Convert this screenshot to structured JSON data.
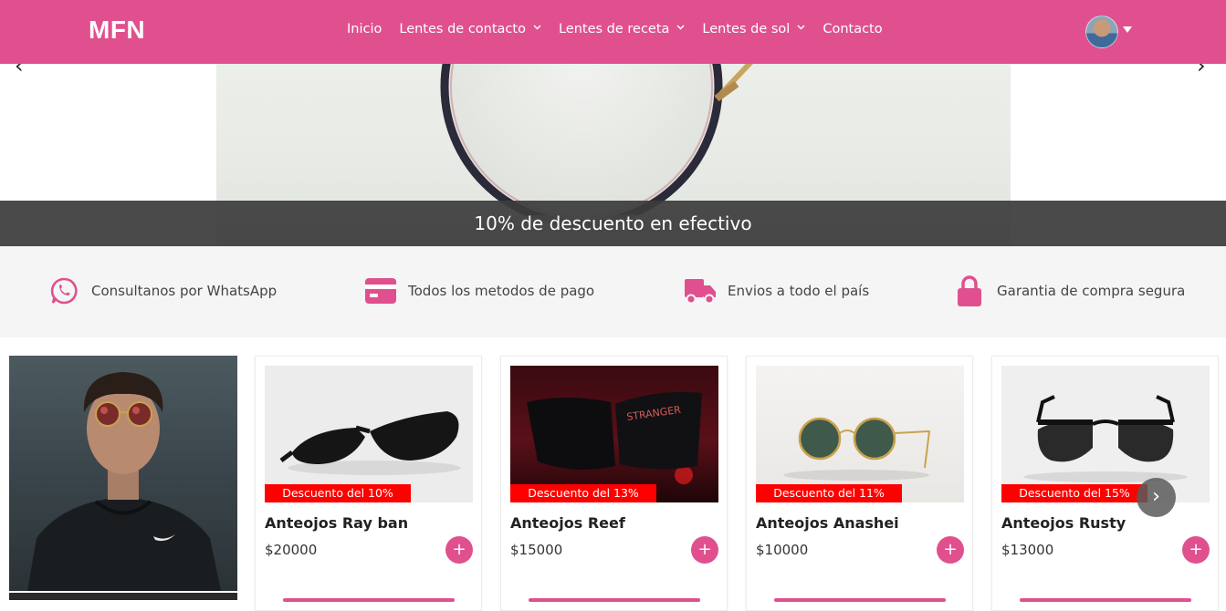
{
  "brand": "MFN",
  "nav": {
    "items": [
      {
        "label": "Inicio",
        "has_dropdown": false
      },
      {
        "label": "Lentes de contacto",
        "has_dropdown": true
      },
      {
        "label": "Lentes de receta",
        "has_dropdown": true
      },
      {
        "label": "Lentes de sol",
        "has_dropdown": true
      },
      {
        "label": "Contacto",
        "has_dropdown": false
      }
    ],
    "chevron": "⌄"
  },
  "hero": {
    "caption": "10% de descuento en efectivo",
    "prev_arrow": "‹",
    "next_arrow": "›"
  },
  "features": [
    {
      "icon": "whatsapp-icon",
      "text": "Consultanos por WhatsApp"
    },
    {
      "icon": "credit-card-icon",
      "text": "Todos los metodos de pago"
    },
    {
      "icon": "truck-icon",
      "text": "Envios a todo el país"
    },
    {
      "icon": "lock-icon",
      "text": "Garantia de compra segura"
    }
  ],
  "products": [
    {
      "name": "Anteojos Ray ban",
      "price": "$20000",
      "discount": "Descuento del 10%",
      "add": "+"
    },
    {
      "name": "Anteojos Reef",
      "price": "$15000",
      "discount": "Descuento del 13%",
      "add": "+"
    },
    {
      "name": "Anteojos Anashei",
      "price": "$10000",
      "discount": "Descuento del 11%",
      "add": "+"
    },
    {
      "name": "Anteojos Rusty",
      "price": "$13000",
      "discount": "Descuento del 15%",
      "add": "+"
    }
  ],
  "carousel_next": "›",
  "colors": {
    "accent": "#e0508e",
    "discount": "#ff0000",
    "caption_bg": "#3c3c3c"
  }
}
